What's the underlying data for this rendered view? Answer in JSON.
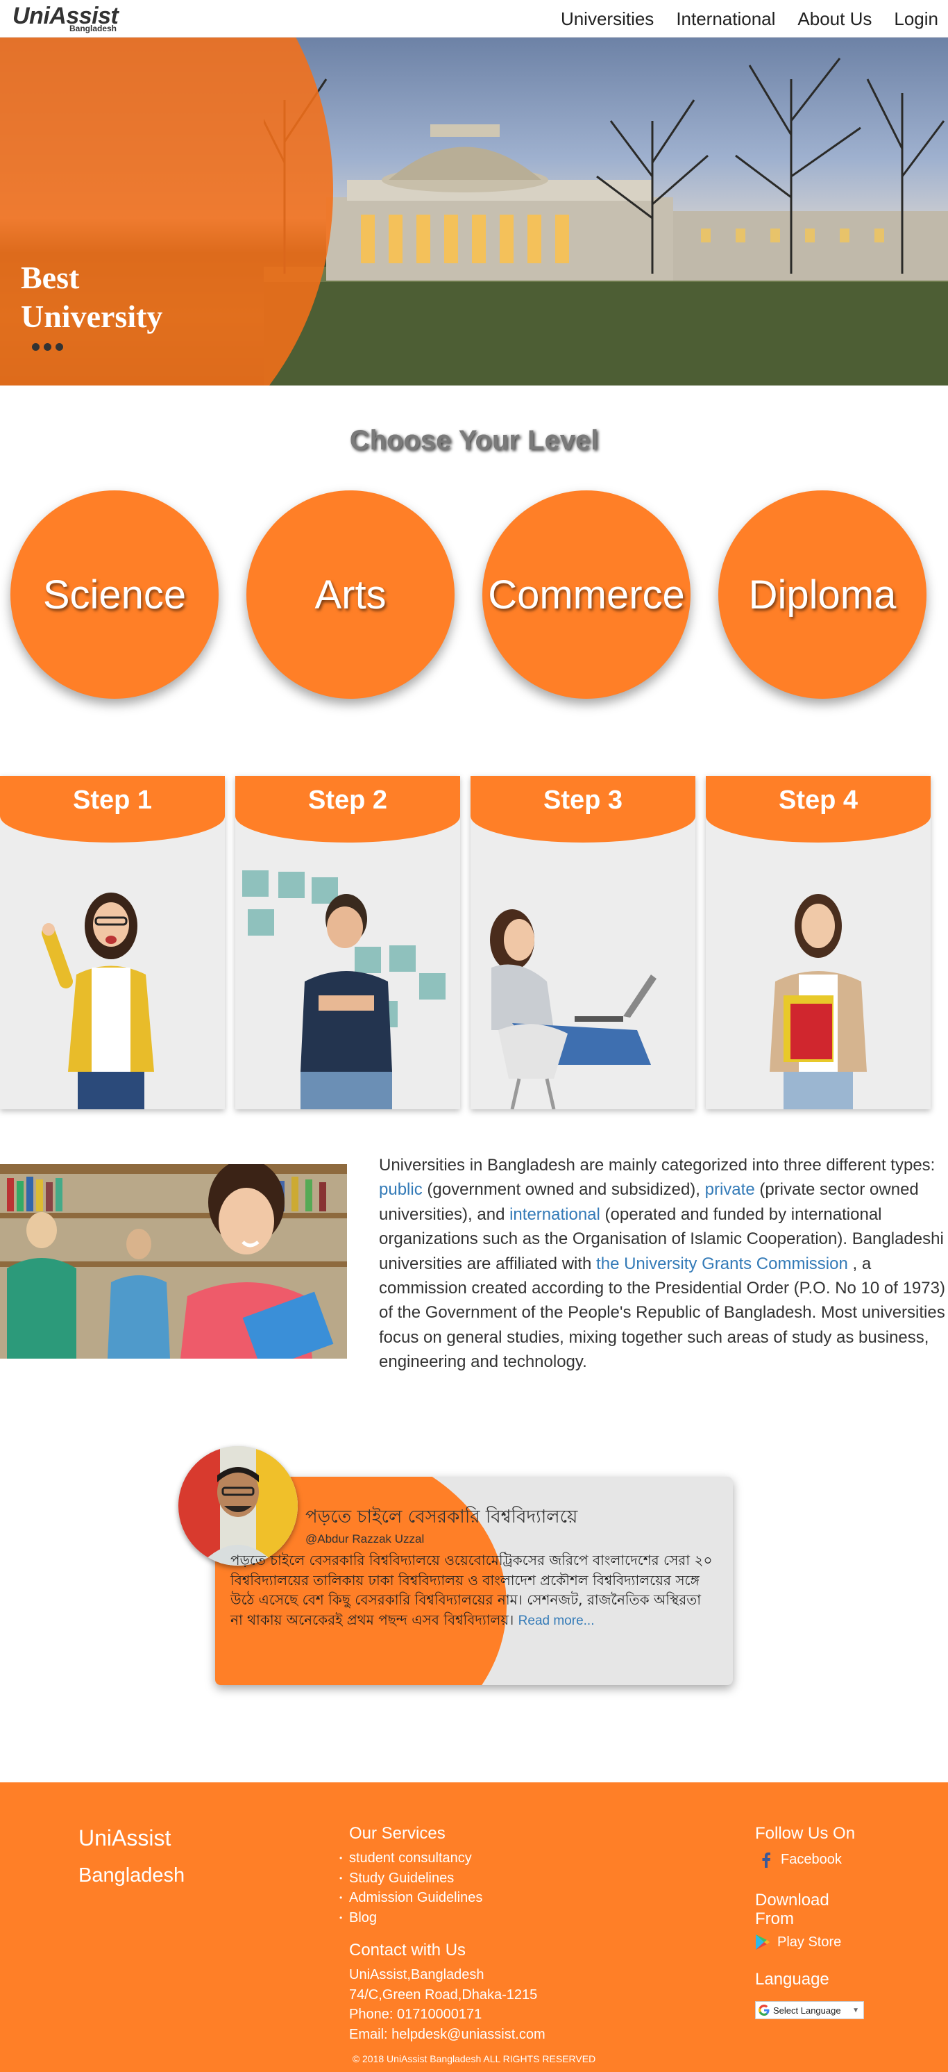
{
  "nav": {
    "logo_text": "UniAssist",
    "logo_sub": "Bangladesh",
    "links": [
      "Universities",
      "International",
      "About Us",
      "Login"
    ]
  },
  "hero": {
    "title_line1": "Best",
    "title_line2": "University"
  },
  "level": {
    "title": "Choose Your Level",
    "options": [
      "Science",
      "Arts",
      "Commerce",
      "Diploma"
    ]
  },
  "steps": [
    "Step 1",
    "Step 2",
    "Step 3",
    "Step 4"
  ],
  "info": {
    "p1": "Universities in Bangladesh are mainly categorized into three different types: ",
    "link_public": "public",
    "p2": " (government owned and subsidized), ",
    "link_private": "private",
    "p3": " (private sector owned universities), and ",
    "link_international": "international",
    "p4": " (operated and funded by international organizations such as the Organisation of Islamic Cooperation). Bangladeshi universities are affiliated with ",
    "link_ugc": "the University Grants Commission",
    "p5": " , a commission created according to the Presidential Order (P.O. No 10 of 1973) of the Government of the People's Republic of Bangladesh. Most universities focus on general studies, mixing together such areas of study as business, engineering and technology."
  },
  "testimonial": {
    "title": "পড়তে চাইলে বেসরকারি বিশ্ববিদ্যালয়ে",
    "handle": "@Abdur Razzak Uzzal",
    "body": "পড়তে চাইলে বেসরকারি বিশ্ববিদ্যালয়ে ওয়েবোমেট্রিকসের জরিপে বাংলাদেশের সেরা ২০ বিশ্ববিদ্যালয়ের তালিকায় ঢাকা বিশ্ববিদ্যালয় ও বাংলাদেশ প্রকৌশল বিশ্ববিদ্যালয়ের সঙ্গে উঠে এসেছে বেশ কিছু বেসরকারি বিশ্ববিদ্যালয়ের নাম। সেশনজট, রাজনৈতিক অস্থিরতা না থাকায় অনেকেরই প্রথম পছন্দ এসব বিশ্ববিদ্যালয়।",
    "read_more": "Read more..."
  },
  "footer": {
    "brand1": "UniAssist",
    "brand2": "Bangladesh",
    "services_title": "Our Services",
    "services": [
      "student consultancy",
      "Study Guidelines",
      "Admission Guidelines",
      "Blog"
    ],
    "contact_title": "Contact with Us",
    "contact": [
      "UniAssist,Bangladesh",
      "74/C,Green Road,Dhaka-1215",
      "Phone: 01710000171",
      "Email: helpdesk@uniassist.com"
    ],
    "follow_title": "Follow Us On",
    "facebook": "Facebook",
    "download_title_1": "Download",
    "download_title_2": "From",
    "playstore": "Play Store",
    "language_title": "Language",
    "language_select": "Select Language",
    "copyright": "© 2018 UniAssist Bangladesh ALL RIGHTS RESERVED"
  },
  "colors": {
    "accent": "#ff7f27",
    "link": "#337ab7",
    "card_bg": "#ededed"
  }
}
